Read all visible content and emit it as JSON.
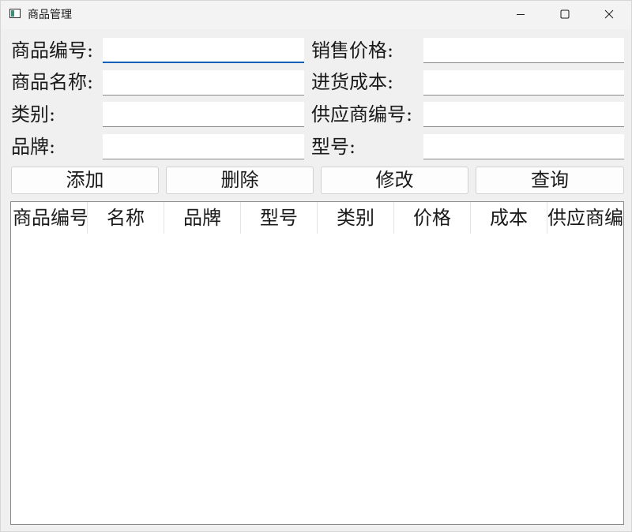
{
  "window": {
    "title": "商品管理",
    "icon": "app-window-icon",
    "controls": {
      "minimize_icon": "minimize-icon",
      "maximize_icon": "maximize-icon",
      "close_icon": "close-icon"
    }
  },
  "form": {
    "product_id": {
      "label": "商品编号:",
      "value": ""
    },
    "product_name": {
      "label": "商品名称:",
      "value": ""
    },
    "category": {
      "label": "类别:",
      "value": ""
    },
    "brand": {
      "label": "品牌:",
      "value": ""
    },
    "sale_price": {
      "label": "销售价格:",
      "value": ""
    },
    "purchase_cost": {
      "label": "进货成本:",
      "value": ""
    },
    "supplier_id": {
      "label": "供应商编号:",
      "value": ""
    },
    "model": {
      "label": "型号:",
      "value": ""
    }
  },
  "actions": {
    "add": "添加",
    "delete": "删除",
    "modify": "修改",
    "query": "查询"
  },
  "table": {
    "columns": [
      "商品编号",
      "名称",
      "品牌",
      "型号",
      "类别",
      "价格",
      "成本",
      "供应商编号"
    ],
    "rows": []
  },
  "colors": {
    "focus_accent": "#005fb8",
    "window_bg": "#f0f0f0"
  }
}
